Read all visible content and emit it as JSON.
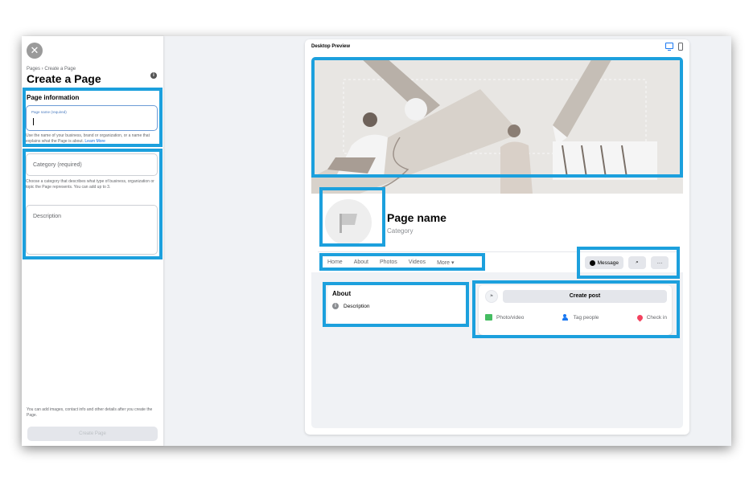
{
  "left_panel": {
    "breadcrumb": "Pages › Create a Page",
    "title": "Create a Page",
    "section_title": "Page information",
    "page_name_label": "Page name (required)",
    "page_name_value": "",
    "page_name_hint": "Use the name of your business, brand or organization, or a name that explains what the Page is about.",
    "learn_more": "Learn More",
    "category_placeholder": "Category (required)",
    "category_hint": "Choose a category that describes what type of business, organization or topic the Page represents. You can add up to 3.",
    "description_placeholder": "Description",
    "footer_note": "You can add images, contact info and other details after you create the Page.",
    "create_button": "Create Page"
  },
  "preview": {
    "title": "Desktop Preview",
    "page_name": "Page name",
    "category": "Category",
    "tabs": [
      "Home",
      "About",
      "Photos",
      "Videos",
      "More ▾"
    ],
    "message_button": "Message",
    "search_glyph": "⌕",
    "more_glyph": "···",
    "about_title": "About",
    "about_description": "Description",
    "create_post": "Create post",
    "post_actions": [
      "Photo/video",
      "Tag people",
      "Check in"
    ]
  },
  "colors": {
    "highlight": "#1ca0dd",
    "accent": "#1877f2"
  }
}
